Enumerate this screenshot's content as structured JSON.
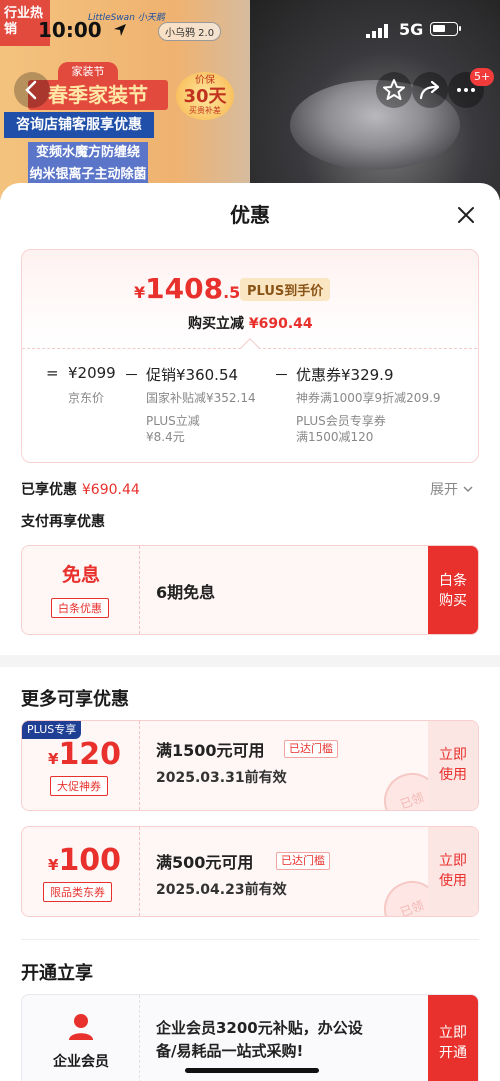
{
  "status_bar": {
    "time": "10:00",
    "network": "5G",
    "battery_level": 0.55
  },
  "hero": {
    "brand": "LittleSwan 小天鹅",
    "ai_label": "小乌鸦 2.0",
    "corner_tag": "行业热销",
    "festival_top": "家装节",
    "festival": "春季家装节",
    "promo": "咨询店铺客服享优惠",
    "feature1": "变频水魔方防缠绕",
    "feature2": "纳米银离子主动除菌",
    "stamp_line1": "价保",
    "stamp_line2": "30天",
    "stamp_line3": "买贵补差",
    "cart_badge": "5+"
  },
  "sheet": {
    "title": "优惠",
    "final_price": {
      "yen": "¥",
      "int": "1408",
      "dec": ".56"
    },
    "plus_tag": "PLUS到手价",
    "reduce_label": "购买立减",
    "reduce_amount": "¥690.44",
    "equation": {
      "eq": "=",
      "base": "¥2099",
      "base_label": "京东价",
      "minus1": "－",
      "promo": "促销¥360.54",
      "promo_sub1": "国家补贴减¥352.14",
      "promo_sub2": "PLUS立减",
      "promo_sub3": "¥8.4元",
      "minus2": "－",
      "coupon": "优惠券¥329.9",
      "coupon_sub1": "神券满1000享9折减209.9",
      "coupon_sub2": "PLUS会员专享券",
      "coupon_sub3": "满1500减120"
    },
    "enjoyed_label": "已享优惠",
    "enjoyed_amount": "¥690.44",
    "expand_label": "展开",
    "pay_title": "支付再享优惠",
    "pay_coupon": {
      "title": "免息",
      "tag": "白条优惠",
      "desc": "6期免息",
      "button_line1": "白条",
      "button_line2": "购买"
    },
    "more_title": "更多可享优惠",
    "coupons": [
      {
        "badge": "PLUS专享",
        "yen": "¥",
        "amount": "120",
        "tag": "大促神券",
        "desc": "满1500元可用",
        "reached": "已达门槛",
        "date": "2025.03.31前有效",
        "button_line1": "立即",
        "button_line2": "使用",
        "stamp": "已领"
      },
      {
        "badge": "",
        "yen": "¥",
        "amount": "100",
        "tag": "限品类东券",
        "desc": "满500元可用",
        "reached": "已达门槛",
        "date": "2025.04.23前有效",
        "button_line1": "立即",
        "button_line2": "使用",
        "stamp": "已领"
      }
    ],
    "open_title": "开通立享",
    "open_card": {
      "label": "企业会员",
      "desc_line1": "企业会员3200元补贴，办公设",
      "desc_line2": "备/易耗品一站式采购!",
      "button_line1": "立即",
      "button_line2": "开通"
    }
  },
  "colors": {
    "accent": "#e8312d",
    "plus_gold": "#fbe6c3",
    "plus_blue": "#1f3f94"
  }
}
